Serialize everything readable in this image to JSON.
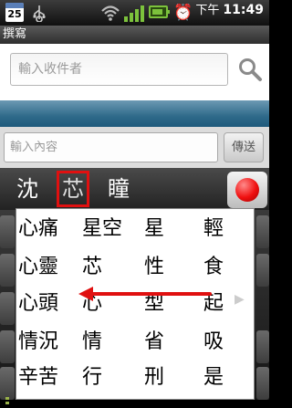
{
  "status_bar": {
    "calendar_day": "25",
    "time_ampm": "下午",
    "time": "11:49",
    "icons": [
      "calendar-icon",
      "usb-icon",
      "wifi-icon",
      "signal-icon",
      "battery-icon",
      "alarm-icon"
    ]
  },
  "title": "撰寫",
  "recipient": {
    "placeholder": "輸入收件者"
  },
  "compose": {
    "placeholder": "輸入內容",
    "send_label": "傳送"
  },
  "candidates": {
    "items": [
      "沈",
      "芯",
      "瞳"
    ],
    "selected_index": 1
  },
  "popup_grid": [
    [
      "心痛",
      "星空",
      "星",
      "輕"
    ],
    [
      "心靈",
      "芯",
      "性",
      "食"
    ],
    [
      "心頭",
      "心",
      "型",
      "起"
    ],
    [
      "情況",
      "情",
      "省",
      "吸"
    ],
    [
      "辛苦",
      "行",
      "刑",
      "是"
    ]
  ],
  "colors": {
    "accent_red": "#e01010",
    "band_blue": "#2f6a8a",
    "signal_green": "#7cc23c"
  }
}
